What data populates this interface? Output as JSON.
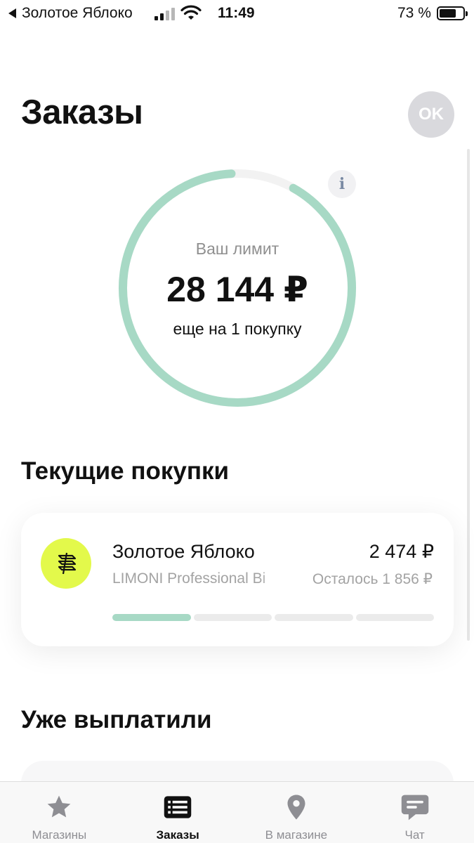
{
  "status_bar": {
    "back_app": "Золотое Яблоко",
    "time": "11:49",
    "battery_percent": "73 %",
    "battery_level": 0.73,
    "icons": [
      "back-arrow-icon",
      "cellular-signal-icon",
      "wifi-icon",
      "battery-icon"
    ]
  },
  "header": {
    "title": "Заказы",
    "avatar_initials": "OK"
  },
  "limit": {
    "label": "Ваш лимит",
    "amount": "28 144 ₽",
    "note": "еще на 1 покупку",
    "info_glyph": "i",
    "ring_available_fraction": 0.91,
    "colors": {
      "available": "#a7d9c5",
      "used": "#f2f2f2"
    }
  },
  "sections": {
    "current": "Текущие покупки",
    "paid": "Уже выплатили"
  },
  "current_purchase": {
    "store": "Золотое Яблоко",
    "product": "LIMONI Professional Bi",
    "amount": "2 474 ₽",
    "remaining": "Осталось 1 856 ₽",
    "payments_total": 4,
    "payments_done": 1,
    "logo_icon": "store-logo-icon",
    "logo_color": "#e3f94b"
  },
  "tab_bar": {
    "active": 1,
    "tabs": [
      {
        "label": "Магазины",
        "icon": "star-icon"
      },
      {
        "label": "Заказы",
        "icon": "orders-list-icon"
      },
      {
        "label": "В магазине",
        "icon": "location-pin-icon"
      },
      {
        "label": "Чат",
        "icon": "chat-icon"
      }
    ]
  }
}
